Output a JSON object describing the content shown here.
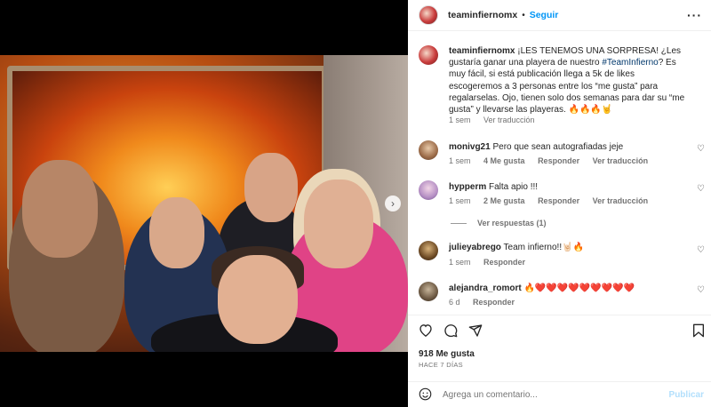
{
  "post": {
    "username": "teaminfiernomx",
    "follow_label": "Seguir",
    "more_icon": "more-options-icon"
  },
  "caption": {
    "username": "teaminfiernomx",
    "text_before": "¡LES TENEMOS UNA SORPRESA! ¿Les gustaría ganar una playera de nuestro ",
    "hashtag": "#TeamInfierno",
    "text_after": "? Es muy fácil, si está publicación llega a 5k de likes escogeremos a 3 personas entre los “me gusta” para regalarselas. Ojo, tienen solo dos semanas para dar su “me gusta” y llevarse las playeras. 🔥🔥🔥🤘",
    "time": "1 sem",
    "translate": "Ver traducción"
  },
  "comments": [
    {
      "username": "monivg21",
      "text": "Pero que sean autografiadas jeje",
      "time": "1 sem",
      "likes": "4 Me gusta",
      "reply": "Responder",
      "translate": "Ver traducción"
    },
    {
      "username": "hypperm",
      "text": "Falta apio !!!",
      "time": "1 sem",
      "likes": "2 Me gusta",
      "reply": "Responder",
      "translate": "Ver traducción"
    },
    {
      "username": "julieyabrego",
      "text": "Team infierno!!🤘🏻🔥",
      "time": "1 sem",
      "reply": "Responder"
    },
    {
      "username": "alejandra_romort",
      "text": "🔥❤️❤️❤️❤️❤️❤️❤️❤️❤️",
      "time": "6 d",
      "reply": "Responder"
    }
  ],
  "view_replies": "Ver respuestas (1)",
  "likes_count": "918 Me gusta",
  "posted_ago": "HACE 7 DÍAS",
  "add_comment": {
    "placeholder": "Agrega un comentario...",
    "post_label": "Publicar"
  },
  "colors": {
    "link": "#0095f6",
    "hashtag": "#00376b",
    "meta": "#737373"
  }
}
